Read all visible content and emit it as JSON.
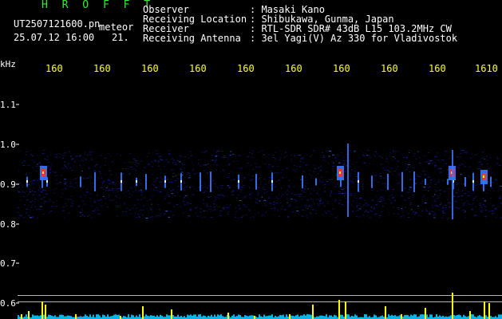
{
  "header": {
    "app_name": "H R O F F T",
    "filename": "UT2507121600.pn",
    "mode": "meteor",
    "datetime": "25.07.12 16:00",
    "count": "21.",
    "labels": {
      "observer": "Observer",
      "location": "Receiving Location",
      "receiver": "Receiver",
      "antenna": "Receiving Antenna"
    },
    "values": {
      "observer": ": Masaki Kano",
      "location": ": Shibukawa, Gunma, Japan",
      "receiver": ": RTL-SDR SDR# 43dB L15 103.2MHz CW",
      "antenna": ": 3el Yagi(V) Az 330 for Vladivostok"
    }
  },
  "axis": {
    "y_unit": "kHz",
    "y_ticks": [
      "1.1",
      "1.0",
      "0.9",
      "0.8",
      "0.7",
      "0.6"
    ],
    "x_ticks": [
      "160",
      "160",
      "160",
      "160",
      "160",
      "160",
      "160",
      "160",
      "160",
      "1610"
    ]
  },
  "colors": {
    "header_text": "#ffffff",
    "value_text": "#ffff55",
    "app_name": "#33ee33",
    "signal_low": "#1a1aa0",
    "signal_mid": "#3a78ff",
    "signal_high": "#ff3030",
    "signal_peak": "#ffff00",
    "baseline": "#00c8ff"
  }
}
